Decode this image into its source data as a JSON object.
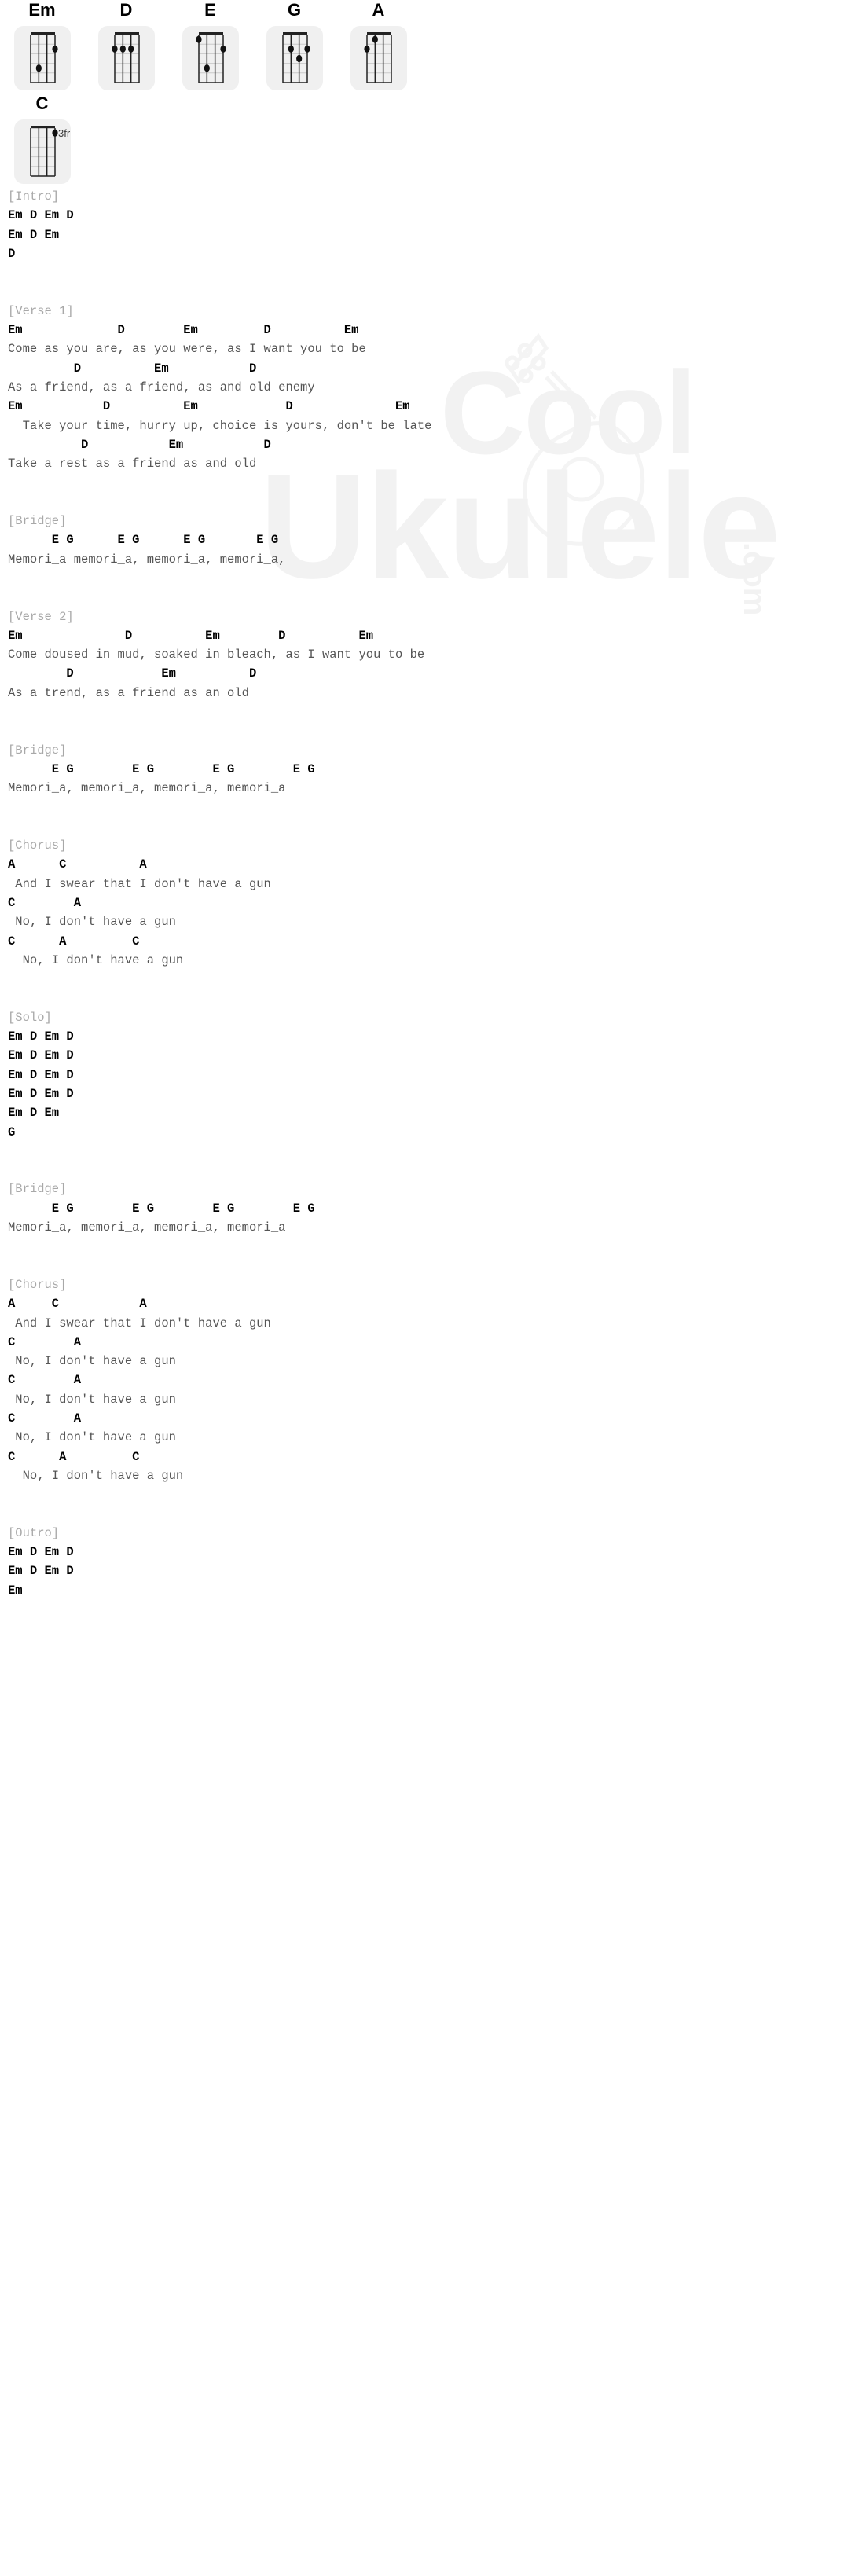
{
  "watermark": {
    "line1": "Cool",
    "line2": "Ukulele",
    "line3": ".com",
    "color": "#f2f2f2"
  },
  "chords": {
    "strings": 4,
    "frets": 5,
    "items": [
      {
        "name": "Em",
        "position_label": "",
        "dots": [
          {
            "string": 4,
            "fret": 2
          },
          {
            "string": 2,
            "fret": 4
          }
        ]
      },
      {
        "name": "D",
        "position_label": "",
        "dots": [
          {
            "string": 1,
            "fret": 2
          },
          {
            "string": 2,
            "fret": 2
          },
          {
            "string": 3,
            "fret": 2
          }
        ]
      },
      {
        "name": "E",
        "position_label": "",
        "dots": [
          {
            "string": 1,
            "fret": 1
          },
          {
            "string": 4,
            "fret": 2
          },
          {
            "string": 2,
            "fret": 4
          }
        ]
      },
      {
        "name": "G",
        "position_label": "",
        "dots": [
          {
            "string": 2,
            "fret": 2
          },
          {
            "string": 4,
            "fret": 2
          },
          {
            "string": 3,
            "fret": 3
          }
        ]
      },
      {
        "name": "A",
        "position_label": "",
        "dots": [
          {
            "string": 2,
            "fret": 1
          },
          {
            "string": 1,
            "fret": 2
          }
        ]
      },
      {
        "name": "C",
        "position_label": "3fr",
        "dots": [
          {
            "string": 4,
            "fret": 1
          }
        ]
      }
    ]
  },
  "song": {
    "sections": [
      {
        "label": "[Intro]",
        "lines": [
          {
            "type": "chord",
            "text": "Em D Em D"
          },
          {
            "type": "chord",
            "text": "Em D Em"
          },
          {
            "type": "chord",
            "text": "D"
          }
        ]
      },
      {
        "label": "[Verse 1]",
        "lines": [
          {
            "type": "chord",
            "text": "Em             D        Em         D          Em"
          },
          {
            "type": "lyric",
            "text": "Come as you are, as you were, as I want you to be"
          },
          {
            "type": "chord",
            "text": "         D          Em           D"
          },
          {
            "type": "lyric",
            "text": "As a friend, as a friend, as and old enemy"
          },
          {
            "type": "chord",
            "text": "Em           D          Em            D              Em"
          },
          {
            "type": "lyric",
            "text": "  Take your time, hurry up, choice is yours, don't be late"
          },
          {
            "type": "chord",
            "text": "          D           Em           D"
          },
          {
            "type": "lyric",
            "text": "Take a rest as a friend as and old"
          }
        ]
      },
      {
        "label": "[Bridge]",
        "lines": [
          {
            "type": "chord",
            "text": "      E G      E G      E G       E G"
          },
          {
            "type": "lyric",
            "text": "Memori_a memori_a, memori_a, memori_a,"
          }
        ]
      },
      {
        "label": "[Verse 2]",
        "lines": [
          {
            "type": "chord",
            "text": "Em              D          Em        D          Em"
          },
          {
            "type": "lyric",
            "text": "Come doused in mud, soaked in bleach, as I want you to be"
          },
          {
            "type": "chord",
            "text": "        D            Em          D"
          },
          {
            "type": "lyric",
            "text": "As a trend, as a friend as an old"
          }
        ]
      },
      {
        "label": "[Bridge]",
        "lines": [
          {
            "type": "chord",
            "text": "      E G        E G        E G        E G"
          },
          {
            "type": "lyric",
            "text": "Memori_a, memori_a, memori_a, memori_a"
          }
        ]
      },
      {
        "label": "[Chorus]",
        "lines": [
          {
            "type": "chord",
            "text": "A      C          A"
          },
          {
            "type": "lyric",
            "text": " And I swear that I don't have a gun"
          },
          {
            "type": "chord",
            "text": "C        A"
          },
          {
            "type": "lyric",
            "text": " No, I don't have a gun"
          },
          {
            "type": "chord",
            "text": "C      A         C"
          },
          {
            "type": "lyric",
            "text": "  No, I don't have a gun"
          }
        ]
      },
      {
        "label": "[Solo]",
        "lines": [
          {
            "type": "chord",
            "text": "Em D Em D"
          },
          {
            "type": "chord",
            "text": "Em D Em D"
          },
          {
            "type": "chord",
            "text": "Em D Em D"
          },
          {
            "type": "chord",
            "text": "Em D Em D"
          },
          {
            "type": "chord",
            "text": "Em D Em"
          },
          {
            "type": "chord",
            "text": "G"
          }
        ]
      },
      {
        "label": "[Bridge]",
        "lines": [
          {
            "type": "chord",
            "text": "      E G        E G        E G        E G"
          },
          {
            "type": "lyric",
            "text": "Memori_a, memori_a, memori_a, memori_a"
          }
        ]
      },
      {
        "label": "[Chorus]",
        "lines": [
          {
            "type": "chord",
            "text": "A     C           A"
          },
          {
            "type": "lyric",
            "text": " And I swear that I don't have a gun"
          },
          {
            "type": "chord",
            "text": "C        A"
          },
          {
            "type": "lyric",
            "text": " No, I don't have a gun"
          },
          {
            "type": "chord",
            "text": "C        A"
          },
          {
            "type": "lyric",
            "text": " No, I don't have a gun"
          },
          {
            "type": "chord",
            "text": "C        A"
          },
          {
            "type": "lyric",
            "text": " No, I don't have a gun"
          },
          {
            "type": "chord",
            "text": "C      A         C"
          },
          {
            "type": "lyric",
            "text": "  No, I don't have a gun"
          }
        ]
      },
      {
        "label": "[Outro]",
        "lines": [
          {
            "type": "chord",
            "text": "Em D Em D"
          },
          {
            "type": "chord",
            "text": "Em D Em D"
          },
          {
            "type": "chord",
            "text": "Em"
          }
        ]
      }
    ]
  }
}
